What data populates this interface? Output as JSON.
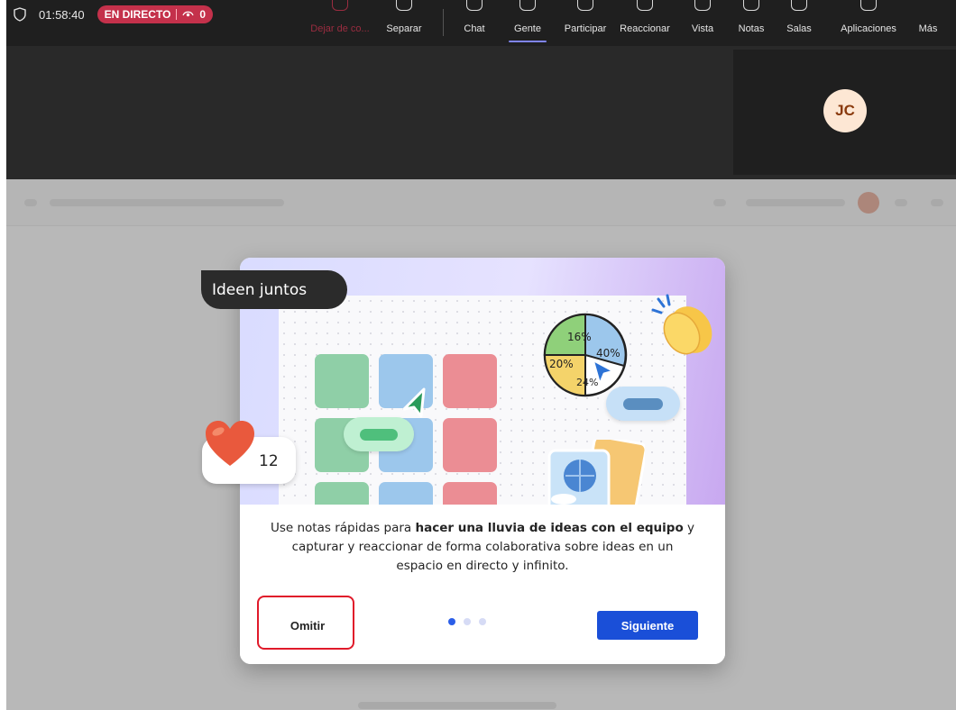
{
  "toolbar": {
    "timer": "01:58:40",
    "live_label": "EN DIRECTO",
    "viewer_count": "0",
    "buttons": [
      {
        "label": "Dejar de co..."
      },
      {
        "label": "Separar"
      },
      {
        "label": "Chat"
      },
      {
        "label": "Gente"
      },
      {
        "label": "Participar"
      },
      {
        "label": "Reaccionar"
      },
      {
        "label": "Vista"
      },
      {
        "label": "Notas"
      },
      {
        "label": "Salas"
      },
      {
        "label": "Aplicaciones"
      },
      {
        "label": "Más"
      }
    ],
    "active_tab": "Gente",
    "accent_color": "#7f85f5",
    "live_color": "#c4314b"
  },
  "participant": {
    "initials": "JC"
  },
  "dialog": {
    "title_badge": "Ideen juntos",
    "heart_count": "12",
    "pie_labels": [
      "16%",
      "40%",
      "20%",
      "24%"
    ],
    "description_pre": "Use notas rápidas para ",
    "description_bold": "hacer una lluvia de ideas con el equipo",
    "description_post": " y capturar y reaccionar de forma colaborativa sobre ideas en un espacio en directo y infinito.",
    "skip_label": "Omitir",
    "next_label": "Siguiente",
    "page_current": 1,
    "page_total": 3,
    "primary_color": "#1a4fd8"
  }
}
